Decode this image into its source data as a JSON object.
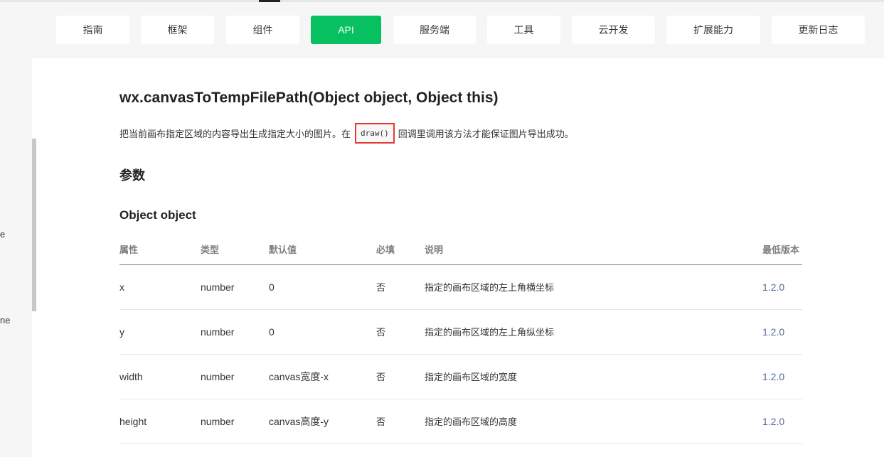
{
  "nav": {
    "tabs": [
      {
        "label": "指南",
        "active": false
      },
      {
        "label": "框架",
        "active": false
      },
      {
        "label": "组件",
        "active": false
      },
      {
        "label": "API",
        "active": true
      },
      {
        "label": "服务端",
        "active": false
      },
      {
        "label": "工具",
        "active": false
      },
      {
        "label": "云开发",
        "active": false
      },
      {
        "label": "扩展能力",
        "active": false
      },
      {
        "label": "更新日志",
        "active": false
      }
    ],
    "active_color": "#07c160"
  },
  "sidebar": {
    "fragments": [
      "e",
      "ne"
    ]
  },
  "doc": {
    "title": "wx.canvasToTempFilePath(Object object, Object this)",
    "desc_before": "把当前画布指定区域的内容导出生成指定大小的图片。在",
    "desc_code": "draw()",
    "desc_after": "回调里调用该方法才能保证图片导出成功。",
    "params_heading": "参数",
    "object_heading": "Object object",
    "table": {
      "headers": [
        "属性",
        "类型",
        "默认值",
        "必填",
        "说明",
        "最低版本"
      ],
      "rows": [
        [
          "x",
          "number",
          "0",
          "否",
          "指定的画布区域的左上角横坐标",
          "1.2.0"
        ],
        [
          "y",
          "number",
          "0",
          "否",
          "指定的画布区域的左上角纵坐标",
          "1.2.0"
        ],
        [
          "width",
          "number",
          "canvas宽度-x",
          "否",
          "指定的画布区域的宽度",
          "1.2.0"
        ],
        [
          "height",
          "number",
          "canvas高度-y",
          "否",
          "指定的画布区域的高度",
          "1.2.0"
        ]
      ]
    },
    "link_color": "#576b95",
    "highlight_color": "#e53935"
  }
}
